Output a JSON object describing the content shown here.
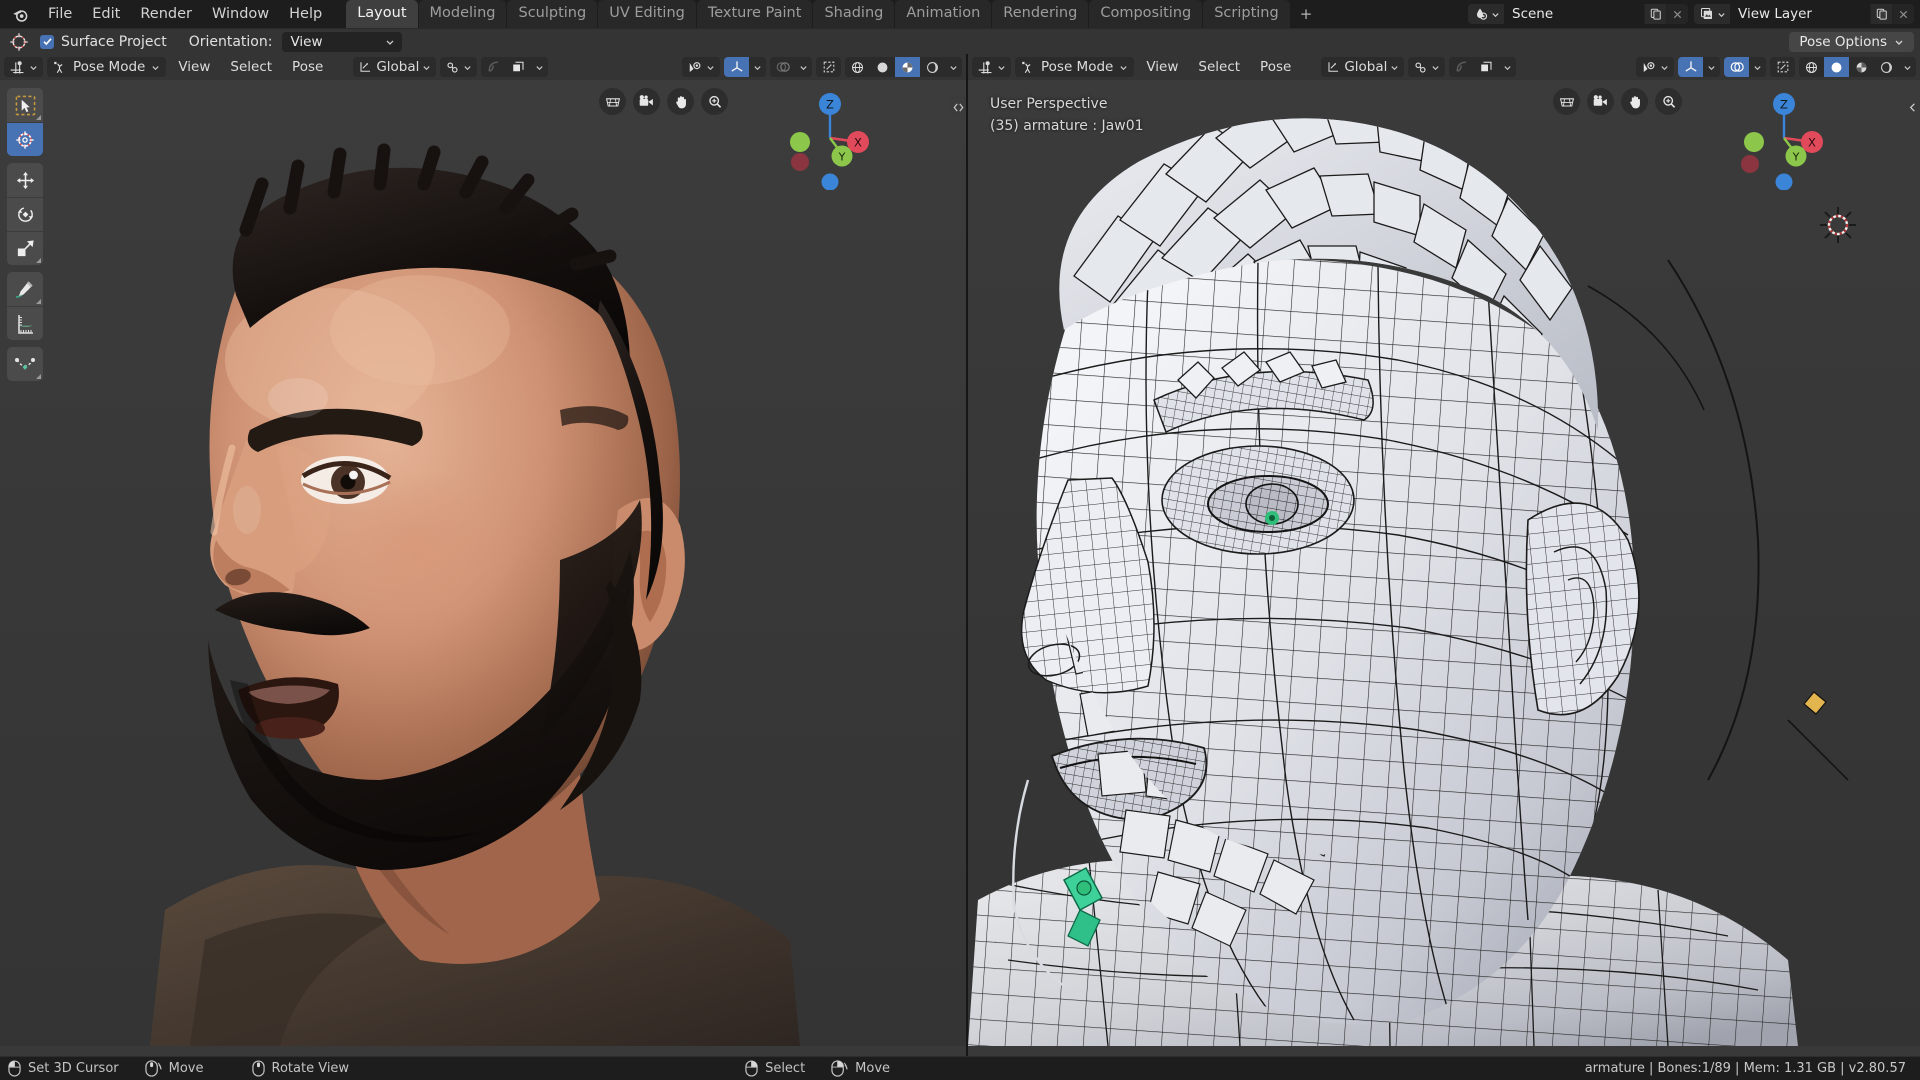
{
  "app": {
    "logo_icon": "blender-logo-icon",
    "version_status": "armature | Bones:1/89  | Mem: 1.31 GB | v2.80.57"
  },
  "topbar": {
    "menus": [
      "File",
      "Edit",
      "Render",
      "Window",
      "Help"
    ],
    "workspace_tabs": [
      {
        "label": "Layout",
        "active": true
      },
      {
        "label": "Modeling",
        "active": false
      },
      {
        "label": "Sculpting",
        "active": false
      },
      {
        "label": "UV Editing",
        "active": false
      },
      {
        "label": "Texture Paint",
        "active": false
      },
      {
        "label": "Shading",
        "active": false
      },
      {
        "label": "Animation",
        "active": false
      },
      {
        "label": "Rendering",
        "active": false
      },
      {
        "label": "Compositing",
        "active": false
      },
      {
        "label": "Scripting",
        "active": false
      }
    ],
    "add_workspace_label": "+",
    "scene": {
      "icon": "scene-icon",
      "value": "Scene",
      "new_icon": "duplicate-icon",
      "unlink_icon": "close-x-icon"
    },
    "view_layer": {
      "icon": "view-layer-icon",
      "value": "View Layer",
      "new_icon": "duplicate-icon",
      "unlink_icon": "close-x-icon"
    }
  },
  "tool_settings": {
    "tool_icon": "cursor-3d-icon",
    "surface_project": {
      "label": "Surface Project",
      "checked": true
    },
    "orientation": {
      "label": "Orientation:",
      "value": "View"
    },
    "pose_options": {
      "label": "Pose Options"
    }
  },
  "viewports": [
    {
      "id": "left",
      "editor_type_icon": "editor-type-3dview-icon",
      "mode": {
        "label": "Pose Mode",
        "icon": "pose-mode-icon"
      },
      "menus": [
        "View",
        "Select",
        "Pose"
      ],
      "transform_orientation": {
        "label": "Global",
        "icon": "orientation-icon"
      },
      "snap": {
        "icon": "snap-magnet-icon"
      },
      "proportional": {
        "icon": "proportional-edit-icon",
        "enabled": false
      },
      "proportional_falloff": {
        "icon": "falloff-smooth-icon"
      },
      "visibility_icon": "visibility-eye-icon",
      "gizmo_icon": "gizmo-axes-icon",
      "gizmo_on": true,
      "overlays_icon": "overlays-icon",
      "overlays_on": false,
      "xray_icon": "xray-icon",
      "shading_modes": [
        {
          "name": "wireframe-shading",
          "icon": "wireframe-globe-icon",
          "active": false
        },
        {
          "name": "solid-shading",
          "icon": "solid-sphere-icon",
          "active": false
        },
        {
          "name": "material-preview-shading",
          "icon": "material-sphere-icon",
          "active": true
        },
        {
          "name": "rendered-shading",
          "icon": "rendered-sphere-icon",
          "active": false
        }
      ],
      "nav_buttons": [
        "zoom-region-icon",
        "camera-view-icon",
        "pan-view-icon",
        "zoom-view-icon"
      ],
      "axis_gizmo": {
        "x": "X",
        "y": "Y",
        "z": "Z"
      },
      "overlay_text": [],
      "collapse_icon": "collapse-arrows-icon",
      "scene_subject": "bearded man head — textured shaded preview"
    },
    {
      "id": "right",
      "editor_type_icon": "editor-type-3dview-icon",
      "mode": {
        "label": "Pose Mode",
        "icon": "pose-mode-icon"
      },
      "menus": [
        "View",
        "Select",
        "Pose"
      ],
      "transform_orientation": {
        "label": "Global",
        "icon": "orientation-icon"
      },
      "snap": {
        "icon": "snap-magnet-icon"
      },
      "proportional": {
        "icon": "proportional-edit-icon",
        "enabled": false
      },
      "proportional_falloff": {
        "icon": "falloff-smooth-icon"
      },
      "visibility_icon": "visibility-eye-icon",
      "gizmo_icon": "gizmo-axes-icon",
      "gizmo_on": true,
      "overlays_icon": "overlays-icon",
      "overlays_on": true,
      "xray_icon": "xray-icon",
      "shading_modes": [
        {
          "name": "wireframe-shading",
          "icon": "wireframe-globe-icon",
          "active": false
        },
        {
          "name": "solid-shading",
          "icon": "solid-sphere-icon",
          "active": true
        },
        {
          "name": "material-preview-shading",
          "icon": "material-sphere-icon",
          "active": false
        },
        {
          "name": "rendered-shading",
          "icon": "rendered-sphere-icon",
          "active": false
        }
      ],
      "nav_buttons": [
        "zoom-region-icon",
        "camera-view-icon",
        "pan-view-icon",
        "zoom-view-icon"
      ],
      "axis_gizmo": {
        "x": "X",
        "y": "Y",
        "z": "Z"
      },
      "overlay_text": [
        "User Perspective",
        "(35) armature : Jaw01"
      ],
      "collapse_icon": "collapse-arrow-icon",
      "scene_subject": "same head — solid shading with wireframe overlay and armature bones"
    }
  ],
  "toolbar_tools": [
    {
      "name": "tweak-select-box-tool",
      "icon": "select-box-cursor-icon",
      "active": false,
      "group": 0
    },
    {
      "name": "cursor-3d-tool",
      "icon": "cursor-3d-icon",
      "active": true,
      "group": 0
    },
    {
      "name": "move-tool",
      "icon": "move-arrows-icon",
      "active": false,
      "group": 1
    },
    {
      "name": "rotate-tool",
      "icon": "rotate-circle-icon",
      "active": false,
      "group": 1
    },
    {
      "name": "scale-tool",
      "icon": "scale-box-icon",
      "active": false,
      "group": 1
    },
    {
      "name": "annotate-tool",
      "icon": "annotate-pencil-icon",
      "active": false,
      "group": 2
    },
    {
      "name": "measure-tool",
      "icon": "measure-ruler-icon",
      "active": false,
      "group": 2
    },
    {
      "name": "bone-envelope-tool",
      "icon": "bone-curve-icon",
      "active": false,
      "group": 3
    }
  ],
  "statusbar": {
    "hints": [
      {
        "mouse": "left-mouse-icon",
        "label": "Set 3D Cursor"
      },
      {
        "mouse": "middle-mouse-drag-icon",
        "label": "Move"
      },
      {
        "mouse": "middle-mouse-icon",
        "label": "Rotate View"
      },
      {
        "mouse": "right-mouse-icon",
        "label": "Select"
      },
      {
        "mouse": "right-mouse-drag-icon",
        "label": "Move"
      }
    ],
    "info": "armature | Bones:1/89  | Mem: 1.31 GB | v2.80.57"
  },
  "colors": {
    "accent_blue": "#4772b3",
    "topbar_bg": "#1d1d1d",
    "header_bg": "#343434",
    "viewport_bg": "#393939",
    "tool_bg": "#4b4b4b",
    "axis_x": "#e04a5a",
    "axis_y": "#8cc64a",
    "axis_z": "#3b85d8",
    "text": "#e5e5e5"
  }
}
